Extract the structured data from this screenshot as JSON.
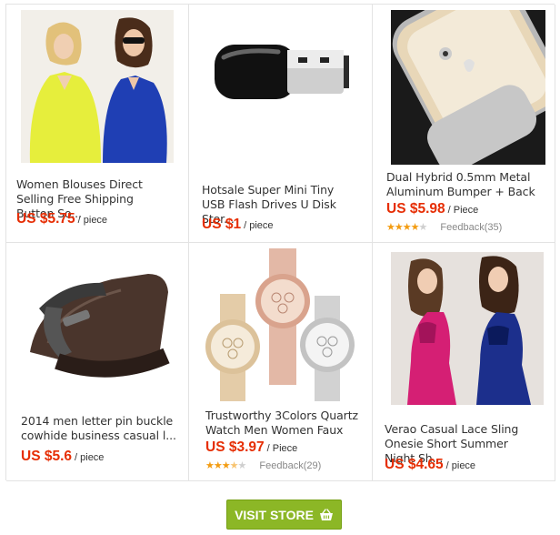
{
  "products": [
    {
      "title": "Women Blouses Direct Selling Free Shipping Button So...",
      "price": "US $5.75",
      "unit": "/ piece",
      "image": "women-blouses-image"
    },
    {
      "title": "Hotsale Super Mini Tiny USB Flash Drives U Disk Stor...",
      "price": "US $1",
      "unit": "/ piece",
      "image": "usb-flash-drive-image"
    },
    {
      "title": "Dual Hybrid 0.5mm Metal Aluminum Bumper + Back",
      "price": "US $5.98",
      "unit": "/ Piece",
      "rating": 4,
      "feedback": "Feedback(35)",
      "image": "phone-bumper-case-image"
    },
    {
      "title": "2014 men letter pin buckle cowhide business casual l...",
      "price": "US $5.6",
      "unit": "/ piece",
      "image": "leather-belt-image"
    },
    {
      "title": "Trustworthy 3Colors Quartz Watch Men Women Faux",
      "price": "US $3.97",
      "unit": "/ Piece",
      "rating": 3.5,
      "feedback": "Feedback(29)",
      "image": "quartz-watches-image"
    },
    {
      "title": "Verao Casual Lace Sling Onesie Short Summer Night Sh...",
      "price": "US $4.65",
      "unit": "/ piece",
      "image": "lace-onesie-image"
    }
  ],
  "cta": {
    "label": "VISIT STORE",
    "icon": "shopping-basket-icon"
  },
  "colors": {
    "price": "#e62e04",
    "button": "#8cb726",
    "star": "#f39c12"
  }
}
